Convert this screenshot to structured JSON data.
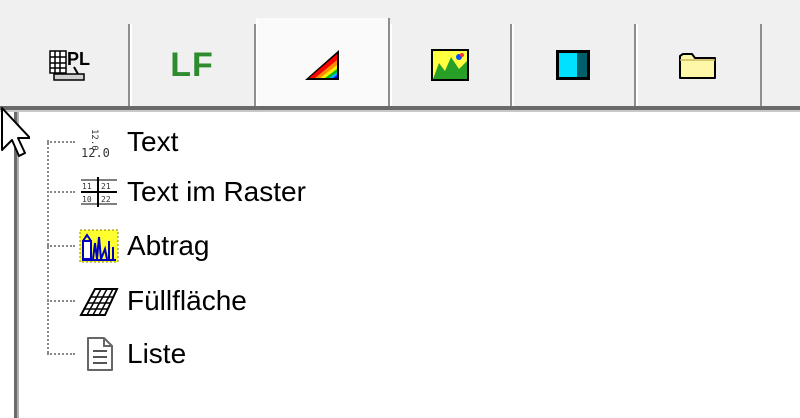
{
  "tabs": [
    {
      "name": "tab-plot",
      "icon": "plot-table-icon"
    },
    {
      "name": "tab-lf",
      "label": "LF"
    },
    {
      "name": "tab-color-scale",
      "icon": "color-scale-icon",
      "active": true
    },
    {
      "name": "tab-map",
      "icon": "map-image-icon"
    },
    {
      "name": "tab-window",
      "icon": "window-icon"
    },
    {
      "name": "tab-folder",
      "icon": "folder-icon"
    }
  ],
  "tree": {
    "items": [
      {
        "label": "Text",
        "icon": "text-number-icon"
      },
      {
        "label": "Text im Raster",
        "icon": "text-grid-icon"
      },
      {
        "label": "Abtrag",
        "icon": "abtrag-chart-icon"
      },
      {
        "label": "Füllfläche",
        "icon": "fill-area-icon"
      },
      {
        "label": "Liste",
        "icon": "list-document-icon"
      }
    ]
  },
  "colors": {
    "lf_green": "#2e8b2e",
    "tab_background": "#f0f0f0",
    "active_tab_background": "#fafafa"
  }
}
